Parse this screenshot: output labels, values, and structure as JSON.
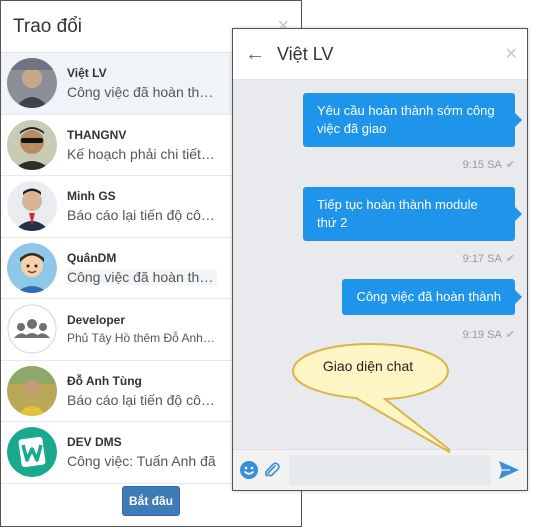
{
  "conversations": {
    "title": "Trao đổi",
    "close_glyph": "×",
    "items": [
      {
        "name": "Việt LV",
        "preview": "Công việc đã hoàn thành",
        "active": true,
        "avatar": "photo-man-1"
      },
      {
        "name": "THANGNV",
        "preview": "Kế hoạch phải chi tiết hơn",
        "avatar": "photo-man-sunglasses"
      },
      {
        "name": "Minh GS",
        "preview": "Báo cáo lại tiến độ công việc",
        "avatar": "photo-man-suit"
      },
      {
        "name": "QuânDM",
        "preview": "Công việc đã hoàn thành",
        "avatar": "cartoon-man"
      },
      {
        "name": "Developer",
        "preview": "Phủ Tây Hồ thêm Đỗ Anh Tùng",
        "avatar": "group-icon"
      },
      {
        "name": "Đỗ Anh Tùng",
        "preview": "Báo cáo lại tiến độ công việc",
        "avatar": "photo-outdoor"
      },
      {
        "name": "DEV DMS",
        "preview": "Công việc: Tuấn Anh đã",
        "avatar": "w-logo"
      }
    ],
    "start_button": "Bắt đầu"
  },
  "chat": {
    "contact_name": "Việt LV",
    "back_glyph": "←",
    "close_glyph": "×",
    "messages": [
      {
        "lines": [
          "Yêu cầu hoàn thành sớm công",
          "việc đã giao"
        ],
        "time": "9:15 SA"
      },
      {
        "lines": [
          "Tiếp tục hoàn thành module",
          "thứ 2"
        ],
        "time": "9:17 SA"
      },
      {
        "lines": [
          "Công việc đã hoàn thành"
        ],
        "time": "9:19 SA"
      }
    ],
    "check_glyph": "✔",
    "input_value": "",
    "input_placeholder": ""
  },
  "annotation": {
    "label": "Giao diện chat"
  },
  "colors": {
    "bubble": "#1e95ea",
    "chat_bg": "#e8eaed",
    "callout_fill": "#fdf6c4",
    "callout_stroke": "#d9b44a",
    "start_button": "#3e7cb8"
  }
}
